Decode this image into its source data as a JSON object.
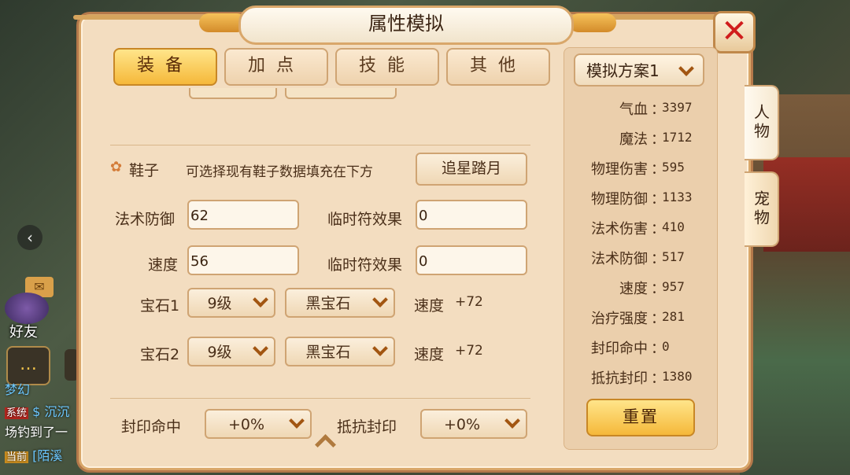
{
  "window": {
    "title": "属性模拟"
  },
  "tabs": [
    {
      "label": "装备",
      "active": true
    },
    {
      "label": "加点",
      "active": false
    },
    {
      "label": "技能",
      "active": false
    },
    {
      "label": "其他",
      "active": false
    }
  ],
  "side_tabs": [
    {
      "label": "人物",
      "active": true
    },
    {
      "label": "宠物",
      "active": false
    }
  ],
  "hud": {
    "friends_label": "好友",
    "chat_line1": "梦幻",
    "chat_sys_tag": "系统",
    "chat_sys_text": "$ 沉沉",
    "chat_line3": "场钓到了一",
    "chat_cur_tag": "当前",
    "chat_cur_text": "[陌溪"
  },
  "shoes": {
    "title": "鞋子",
    "hint": "可选择现有鞋子数据填充在下方",
    "preset_button": "追星踏月",
    "magic_def_label": "法术防御",
    "magic_def_value": "62",
    "speed_label": "速度",
    "speed_value": "56",
    "temp_label_1": "临时符效果",
    "temp_value_1": "0",
    "temp_label_2": "临时符效果",
    "temp_value_2": "0",
    "gem1_label": "宝石1",
    "gem1_level": "9级",
    "gem1_type": "黑宝石",
    "gem1_attr": "速度",
    "gem1_bonus": "+72",
    "gem2_label": "宝石2",
    "gem2_level": "9级",
    "gem2_type": "黑宝石",
    "gem2_attr": "速度",
    "gem2_bonus": "+72"
  },
  "bottom": {
    "seal_hit_label": "封印命中",
    "seal_hit_value": "+0%",
    "seal_res_label": "抵抗封印",
    "seal_res_value": "+0%"
  },
  "stats_panel": {
    "plan_label": "模拟方案1",
    "colon": "：",
    "stats": [
      {
        "name": "气血",
        "value": "3397"
      },
      {
        "name": "魔法",
        "value": "1712"
      },
      {
        "name": "物理伤害",
        "value": "595"
      },
      {
        "name": "物理防御",
        "value": "1133"
      },
      {
        "name": "法术伤害",
        "value": "410"
      },
      {
        "name": "法术防御",
        "value": "517"
      },
      {
        "name": "速度",
        "value": "957"
      },
      {
        "name": "治疗强度",
        "value": "281"
      },
      {
        "name": "封印命中",
        "value": "0"
      },
      {
        "name": "抵抗封印",
        "value": "1380"
      }
    ],
    "reset_label": "重置"
  },
  "colors": {
    "accent": "#f5b83a",
    "panel": "#f3ddc0",
    "border": "#cfa473",
    "close": "#d01c1c"
  }
}
